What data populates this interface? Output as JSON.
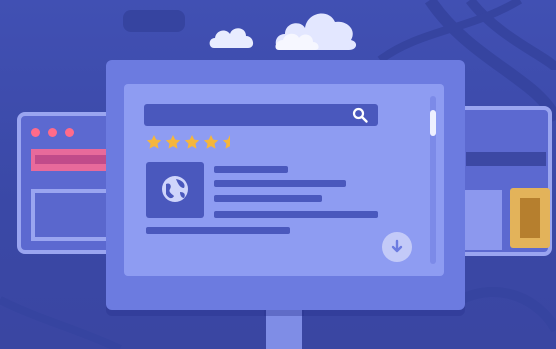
{
  "illustration": {
    "rating": {
      "value": 4.5,
      "max": 5
    },
    "colors": {
      "background": "#3d4aa8",
      "monitor_frame": "#6c7be0",
      "screen": "#8e9cf2",
      "accent_pink": "#e86a9b",
      "accent_gold": "#e3b35a",
      "star": "#f5b63c",
      "cloud": "#eef0ff"
    },
    "icons": [
      "search-icon",
      "globe-icon",
      "download-icon",
      "star-icon",
      "cloud-icon"
    ]
  }
}
